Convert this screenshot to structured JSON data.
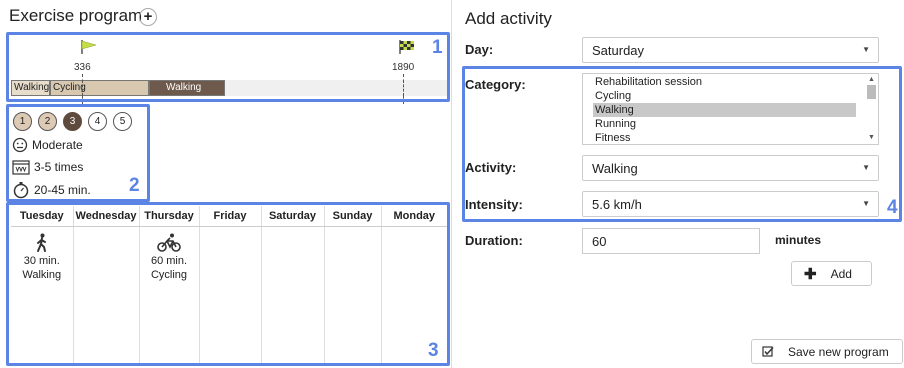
{
  "left": {
    "title": "Exercise program",
    "add_symbol": "+",
    "markers": [
      "1",
      "2",
      "3",
      "4"
    ],
    "timeline": {
      "start_label": "336",
      "end_label": "1890",
      "segments": [
        {
          "label": "Walking",
          "color": "#e8dccb"
        },
        {
          "label": "Cycling",
          "color": "#d8c8b0"
        },
        {
          "label": "Walking",
          "color": "#6e5a4c"
        }
      ]
    },
    "levels": [
      "1",
      "2",
      "3",
      "4",
      "5"
    ],
    "selected_level": 3,
    "intensity_label": "Moderate",
    "frequency_label": "3-5 times",
    "duration_label": "20-45 min.",
    "days": [
      "Tuesday",
      "Wednesday",
      "Thursday",
      "Friday",
      "Saturday",
      "Sunday",
      "Monday"
    ],
    "schedule": [
      {
        "duration": "30 min.",
        "activity": "Walking",
        "icon": "walking-person-icon"
      },
      {
        "duration": "60 min.",
        "activity": "Cycling",
        "icon": "cyclist-icon"
      }
    ]
  },
  "right": {
    "title": "Add activity",
    "day_label": "Day:",
    "day_value": "Saturday",
    "category_label": "Category:",
    "category_options": [
      "Rehabilitation session",
      "Cycling",
      "Walking",
      "Running",
      "Fitness"
    ],
    "category_selected": "Walking",
    "activity_label": "Activity:",
    "activity_value": "Walking",
    "intensity_label": "Intensity:",
    "intensity_value": "5.6 km/h",
    "duration_label": "Duration:",
    "duration_value": "60",
    "duration_unit": "minutes",
    "add_button": "Add",
    "save_button": "Save new program",
    "marker": "4"
  },
  "colors": {
    "highlight": "#5b84e4",
    "selected_level": "#5f4b3e",
    "level_fill": "#dccab5"
  }
}
